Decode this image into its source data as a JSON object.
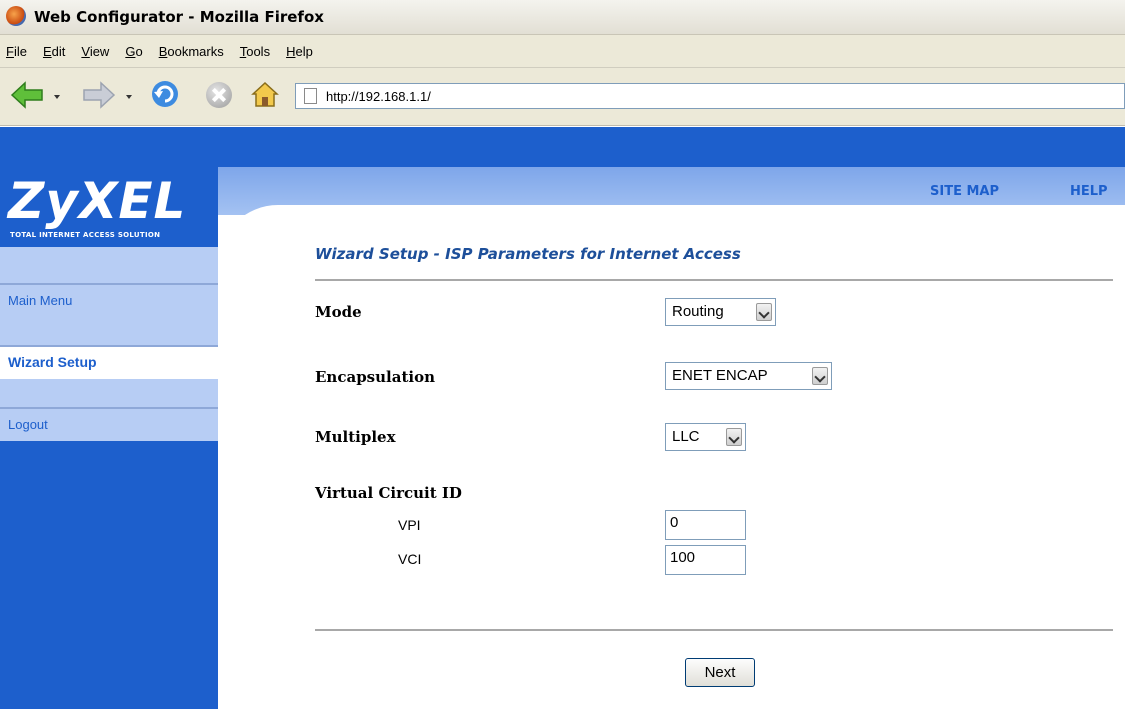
{
  "window": {
    "title": "Web Configurator - Mozilla Firefox"
  },
  "menubar": {
    "items": [
      "File",
      "Edit",
      "View",
      "Go",
      "Bookmarks",
      "Tools",
      "Help"
    ]
  },
  "navbar": {
    "url": "http://192.168.1.1/"
  },
  "header": {
    "logo": "ZyXEL",
    "logo_tagline": "TOTAL INTERNET ACCESS SOLUTION",
    "site_map_link": "SITE MAP",
    "help_link": "HELP"
  },
  "sidebar": {
    "items": [
      {
        "label": "Main Menu",
        "active": false
      },
      {
        "label": "Wizard Setup",
        "active": true
      },
      {
        "label": "Logout",
        "active": false
      }
    ]
  },
  "form": {
    "title": "Wizard Setup - ISP Parameters for Internet Access",
    "mode_label": "Mode",
    "mode_value": "Routing",
    "encapsulation_label": "Encapsulation",
    "encapsulation_value": "ENET ENCAP",
    "multiplex_label": "Multiplex",
    "multiplex_value": "LLC",
    "vc_label": "Virtual Circuit ID",
    "vpi_label": "VPI",
    "vpi_value": "0",
    "vci_label": "VCI",
    "vci_value": "100",
    "next_button": "Next"
  },
  "colors": {
    "brand_blue": "#1d5fcc",
    "sidebar_light": "#b7cdf4",
    "title_blue": "#1d4f9a"
  }
}
